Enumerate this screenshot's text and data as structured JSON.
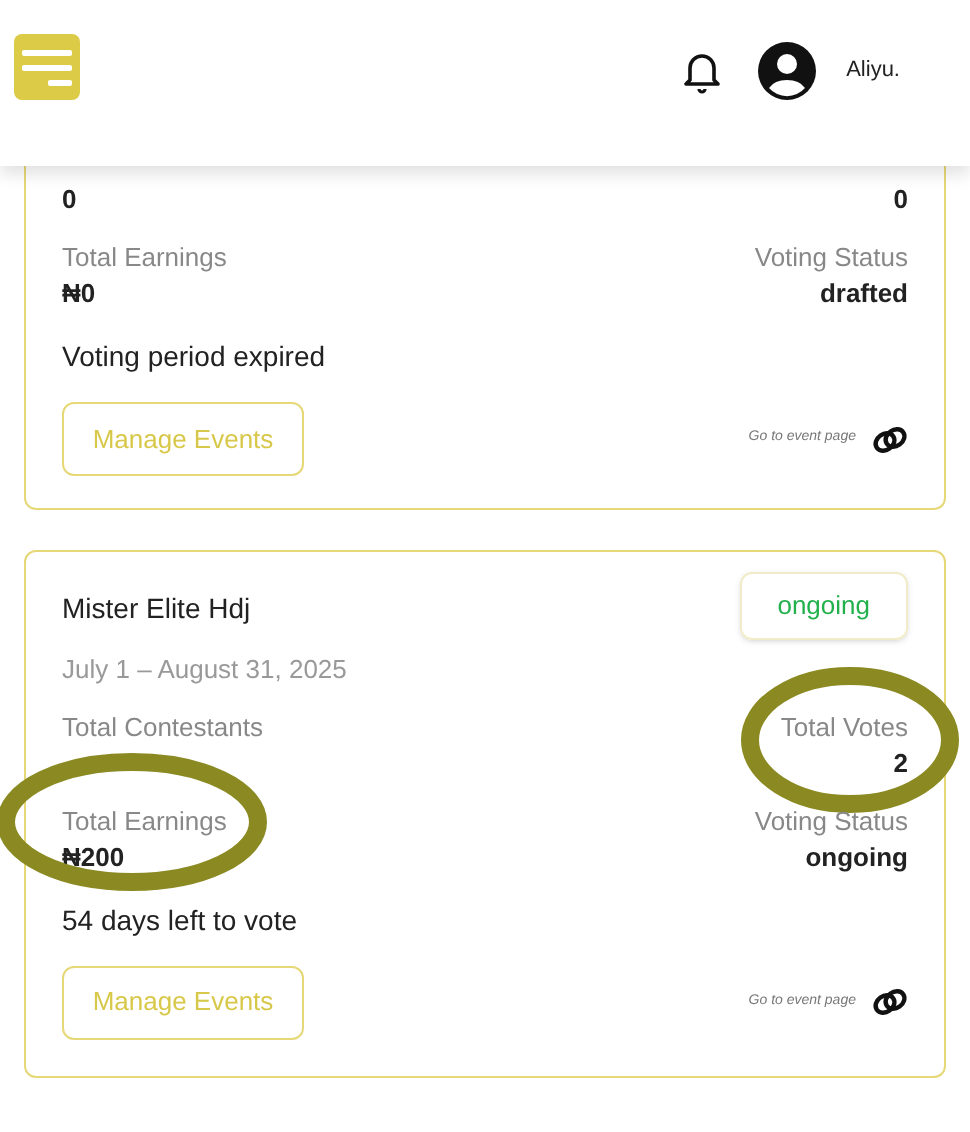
{
  "header": {
    "user_name": "Aliyu."
  },
  "events": [
    {
      "stats": [
        [
          {
            "value": "0",
            "circled": false
          },
          {
            "value": "0",
            "circled": false
          }
        ],
        [
          {
            "label": "Total Earnings",
            "value": "₦0",
            "circled": false
          },
          {
            "label": "Voting Status",
            "value": "drafted",
            "circled": false
          }
        ]
      ],
      "note": "Voting period expired",
      "button": "Manage Events",
      "link": "Go to event page"
    },
    {
      "name": "Mister Elite Hdj",
      "badge": "ongoing",
      "dates": "July 1 – August 31, 2025",
      "stats": [
        [
          {
            "label": "Total Contestants",
            "circled": false
          },
          {
            "label": "Total Votes",
            "value": "2",
            "circled": true
          }
        ],
        [
          {
            "label": "Total Earnings",
            "value": "₦200",
            "circled": true
          },
          {
            "label": "Voting Status",
            "value": "ongoing",
            "circled": false
          }
        ]
      ],
      "note": "54 days left to vote",
      "button": "Manage Events",
      "link": "Go to event page"
    }
  ]
}
